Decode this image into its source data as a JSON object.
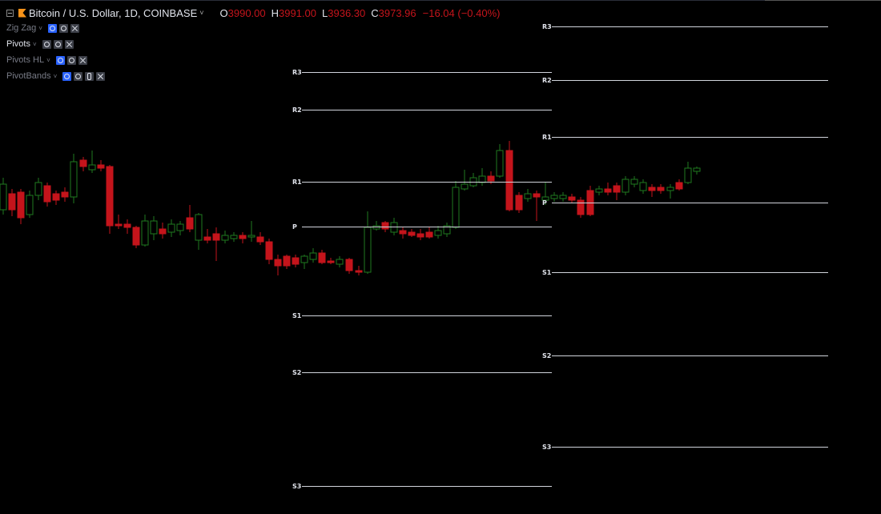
{
  "header": {
    "symbol": "Bitcoin / U.S. Dollar, 1D, COINBASE",
    "ohlc": {
      "o_label": "O",
      "o_value": "3990.00",
      "h_label": "H",
      "h_value": "3991.00",
      "l_label": "L",
      "l_value": "3936.30",
      "c_label": "C",
      "c_value": "3973.96",
      "change": "−16.04 (−0.40%)"
    }
  },
  "indicators": [
    {
      "name": "Zig Zag",
      "buttons": [
        "visibility",
        "settings",
        "remove"
      ]
    },
    {
      "name": "Pivots",
      "buttons": [
        "visibility",
        "settings",
        "remove"
      ]
    },
    {
      "name": "Pivots HL",
      "buttons": [
        "visibility",
        "settings",
        "remove"
      ]
    },
    {
      "name": "PivotBands",
      "buttons": [
        "visibility",
        "settings",
        "source",
        "remove"
      ]
    }
  ],
  "pivot_levels": {
    "period1": {
      "R3": "R3",
      "R2": "R2",
      "R1": "R1",
      "P": "P",
      "S1": "S1",
      "S2": "S2",
      "S3": "S3"
    },
    "period2": {
      "R3": "R3",
      "R2": "R2",
      "R1": "R1",
      "P": "P",
      "S1": "S1",
      "S2": "S2",
      "S3": "S3"
    }
  },
  "colors": {
    "background": "#000000",
    "up": "#1f7a1f",
    "down": "#c4141b",
    "pivot_line": "#d1d4dc",
    "text": "#e0e3eb",
    "muted": "#787b86",
    "btc": "#f7931a"
  },
  "icons": [
    "collapse-icon",
    "bitcoin-icon",
    "chevron-down-icon",
    "eye-icon",
    "gear-icon",
    "source-code-icon",
    "close-icon"
  ]
}
